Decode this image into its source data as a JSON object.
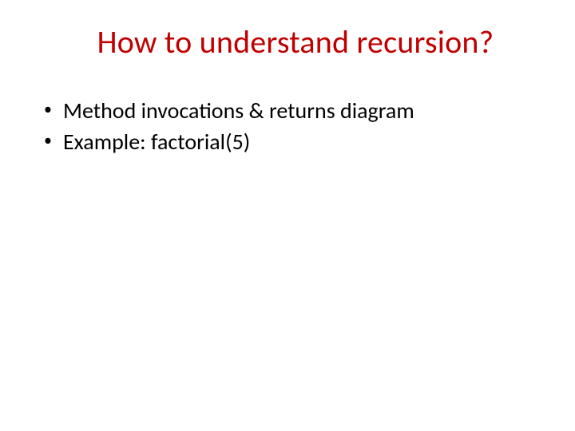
{
  "slide": {
    "title": "How to understand recursion?",
    "bullets": [
      "Method invocations & returns diagram",
      "Example: factorial(5)"
    ],
    "colors": {
      "title": "#c00000",
      "body": "#000000",
      "background": "#ffffff"
    }
  }
}
